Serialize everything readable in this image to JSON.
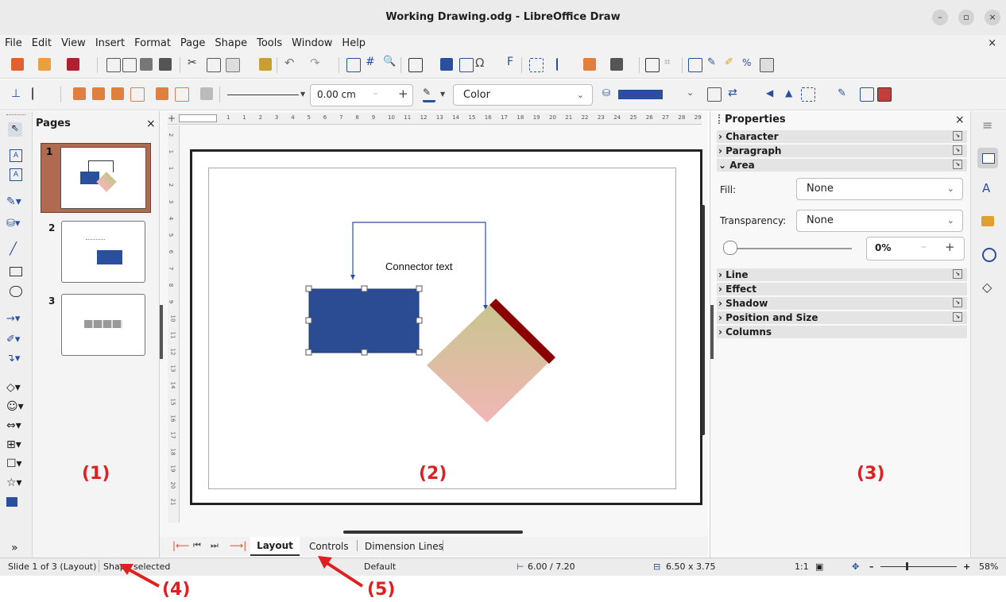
{
  "window": {
    "title": "Working Drawing.odg - LibreOffice Draw",
    "min": "–",
    "max": "▫",
    "close": "×"
  },
  "menu": [
    "File",
    "Edit",
    "View",
    "Insert",
    "Format",
    "Page",
    "Shape",
    "Tools",
    "Window",
    "Help"
  ],
  "menu_close": "×",
  "toolbar2": {
    "width_value": "0.00 cm",
    "minus": "–",
    "plus": "+",
    "fill_style": "Color"
  },
  "pages_pane": {
    "title": "Pages",
    "close": "×",
    "pages": [
      {
        "num": "1"
      },
      {
        "num": "2"
      },
      {
        "num": "3"
      }
    ],
    "more": "»"
  },
  "drawing": {
    "connector_text": "Connector text"
  },
  "tabs": {
    "layout": "Layout",
    "controls": "Controls",
    "dimension": "Dimension Lines"
  },
  "ruler": {
    "h_ticks": [
      "1",
      "1",
      "2",
      "3",
      "4",
      "5",
      "6",
      "7",
      "8",
      "9",
      "10",
      "11",
      "12",
      "13",
      "14",
      "15",
      "16",
      "17",
      "18",
      "19",
      "20",
      "21",
      "22",
      "23",
      "24",
      "25",
      "26",
      "27",
      "28",
      "29"
    ],
    "v_ticks": [
      "2",
      "1",
      "1",
      "2",
      "3",
      "4",
      "5",
      "6",
      "7",
      "8",
      "9",
      "10",
      "11",
      "12",
      "13",
      "14",
      "15",
      "16",
      "17",
      "18",
      "19",
      "20",
      "21"
    ]
  },
  "properties": {
    "title": "Properties",
    "close": "×",
    "sections_top": [
      "Character",
      "Paragraph",
      "Area"
    ],
    "fill_label": "Fill:",
    "fill_value": "None",
    "transparency_label": "Transparency:",
    "transparency_value": "None",
    "transparency_percent": "0%",
    "trans_minus": "–",
    "trans_plus": "+",
    "sections_bottom": [
      "Line",
      "Effect",
      "Shadow",
      "Position and Size",
      "Columns"
    ]
  },
  "sidebar_deck": {
    "menu": "≡"
  },
  "status": {
    "slide": "Slide 1 of 3 (Layout)",
    "selection": "Shape selected",
    "layout_name": "Default",
    "position": "6.00 / 7.20",
    "size": "6.50 x 3.75",
    "scale": "1:1",
    "zoom_minus": "–",
    "zoom_plus": "+",
    "zoom": "58%"
  },
  "callouts": [
    "(1)",
    "(2)",
    "(3)",
    "(4)",
    "(5)"
  ],
  "colors": {
    "rect_fill": "#2b4b93",
    "arrow_red": "#e02020",
    "diamond_top": "#c8c58e",
    "diamond_bottom": "#f2b6b6",
    "diamond_edge": "#8b0000"
  }
}
